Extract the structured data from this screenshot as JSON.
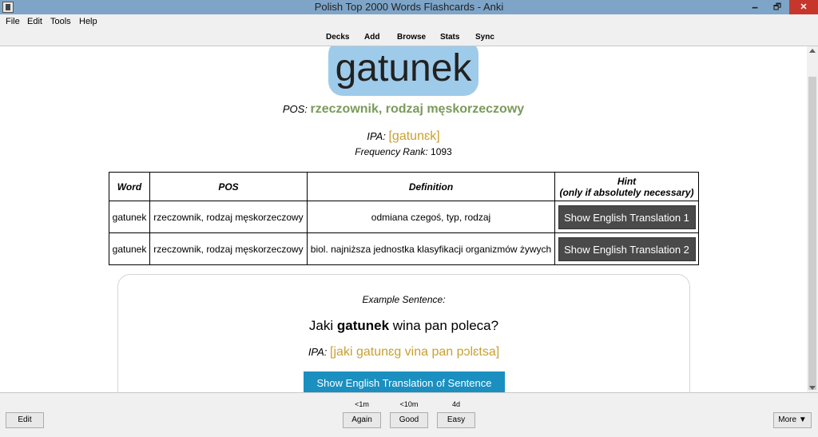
{
  "window": {
    "title": "Polish Top 2000 Words Flashcards - Anki",
    "minimize_glyph": "🗕",
    "maximize_glyph": "🗗",
    "close_glyph": "✕",
    "icon": "anki-app-icon"
  },
  "menu": [
    "File",
    "Edit",
    "Tools",
    "Help"
  ],
  "toolbar": [
    "Decks",
    "Add",
    "Browse",
    "Stats",
    "Sync"
  ],
  "card": {
    "word": "gatunek",
    "pos_label": "POS:",
    "pos_value": "rzeczownik, rodzaj męskorzeczowy",
    "ipa_label": "IPA:",
    "ipa_value": "[gatunɛk]",
    "freq_label": "Frequency Rank:",
    "freq_value": "1093",
    "table": {
      "headers": [
        "Word",
        "POS",
        "Definition"
      ],
      "hint_header_line1": "Hint",
      "hint_header_line2": "(only if absolutely necessary)",
      "rows": [
        {
          "word": "gatunek",
          "pos": "rzeczownik, rodzaj męskorzeczowy",
          "definition": "odmiana czegoś, typ, rodzaj",
          "hint_button": "Show English Translation 1"
        },
        {
          "word": "gatunek",
          "pos": "rzeczownik, rodzaj męskorzeczowy",
          "definition": "biol. najniższa jednostka klasyfikacji organizmów żywych",
          "hint_button": "Show English Translation 2"
        }
      ]
    },
    "example": {
      "label": "Example Sentence:",
      "sentence_before": "Jaki ",
      "sentence_bold": "gatunek",
      "sentence_after": " wina pan poleca?",
      "ipa_label": "IPA:",
      "ipa_value": "[jaki gatunɛg vina pan pɔlɛtsa]",
      "button": "Show English Translation of Sentence"
    }
  },
  "bottom": {
    "edit": "Edit",
    "more": "More ▼",
    "answers": [
      {
        "label": "Again",
        "time": "<1m"
      },
      {
        "label": "Good",
        "time": "<10m"
      },
      {
        "label": "Easy",
        "time": "4d"
      }
    ]
  },
  "colors": {
    "title_bar": "#7ea5c8",
    "word_box": "#9ecbea",
    "pos_green": "#7a9a5a",
    "ipa_gold": "#c9a02f",
    "hint_button": "#4a4a4a",
    "sentence_button": "#1a8fc0",
    "close_button": "#c7362b"
  }
}
